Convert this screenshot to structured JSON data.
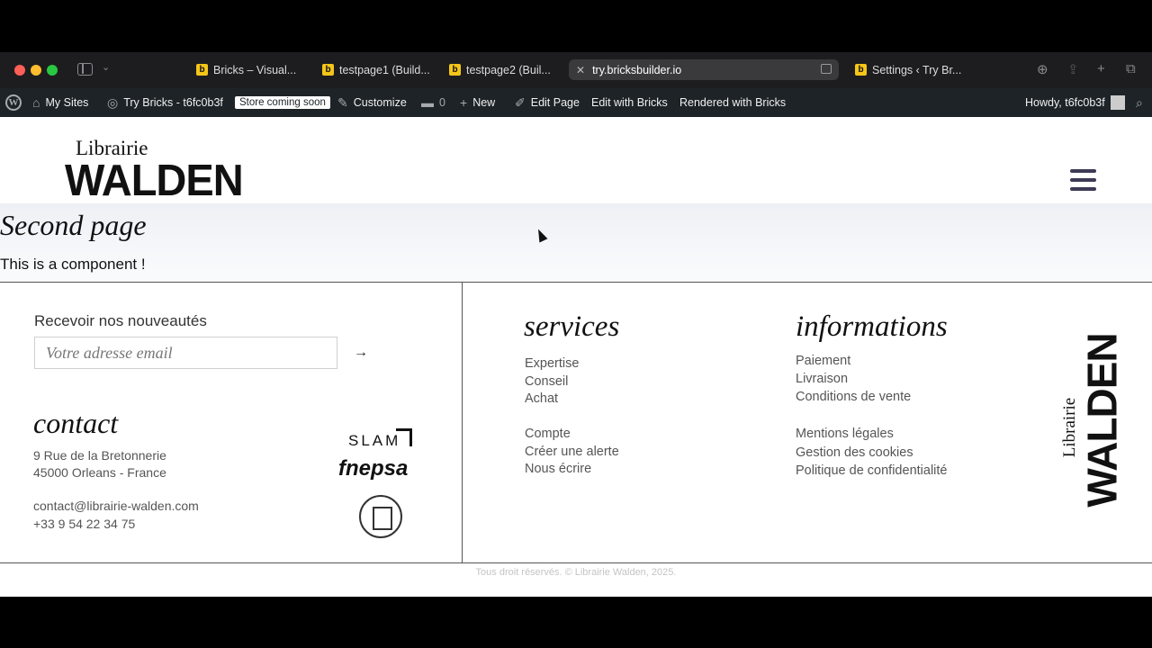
{
  "browser": {
    "tabs": [
      {
        "label": "Bricks – Visual...",
        "active": false
      },
      {
        "label": "testpage1 (Build...",
        "active": false
      },
      {
        "label": "testpage2 (Buil...",
        "active": false
      },
      {
        "label": "try.bricksbuilder.io",
        "active": true
      },
      {
        "label": "Settings ‹ Try Br...",
        "active": false
      }
    ]
  },
  "wpbar": {
    "my_sites": "My Sites",
    "site_name": "Try Bricks - t6fc0b3f",
    "store_badge": "Store coming soon",
    "customize": "Customize",
    "comments_count": "0",
    "new": "New",
    "edit_page": "Edit Page",
    "edit_with_bricks": "Edit with Bricks",
    "rendered_with_bricks": "Rendered with Bricks",
    "howdy": "Howdy, t6fc0b3f"
  },
  "header": {
    "logo_top": "Librairie",
    "logo_main": "WALDEN"
  },
  "content": {
    "title": "Second page",
    "text": "This is a component !"
  },
  "footer": {
    "newsletter_label": "Recevoir nos nouveautés",
    "email_placeholder": "Votre adresse email",
    "submit_arrow": "→",
    "contact_title": "contact",
    "address_line1": "9 Rue de la Bretonnerie",
    "address_line2": "45000 Orleans - France",
    "email": "contact@librairie-walden.com",
    "phone": "+33 9 54 22 34 75",
    "partner_slam": "SLAM",
    "partner_fnepsa": "fnepsa",
    "services_title": "services",
    "services": [
      "Expertise",
      "Conseil",
      "Achat"
    ],
    "account_links": [
      "Compte",
      "Créer une alerte",
      "Nous écrire"
    ],
    "info_title": "informations",
    "info_links": [
      "Paiement",
      "Livraison",
      "Conditions de vente"
    ],
    "legal_links": [
      "Mentions légales",
      "Gestion des cookies",
      "Politique de confidentialité"
    ],
    "vertical_logo_top": "Librairie",
    "vertical_logo_main": "WALDEN",
    "copyright": "Tous droit réservés. © Librairie Walden, 2025."
  }
}
